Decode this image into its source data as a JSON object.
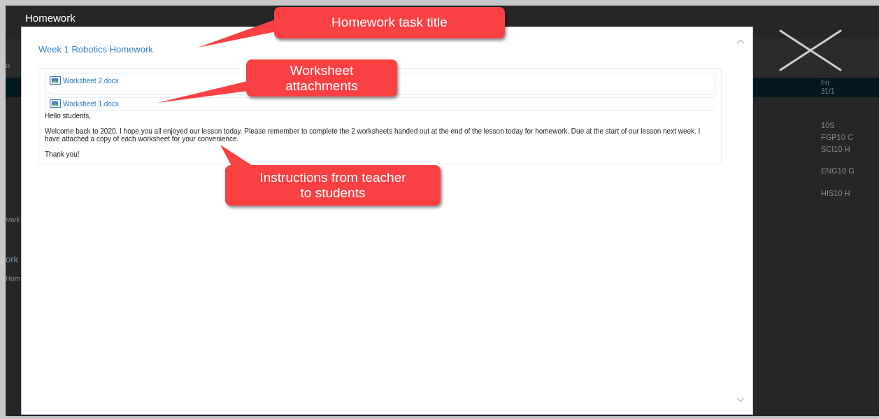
{
  "window": {
    "title": "Homework"
  },
  "background_page": {
    "left_texts": [
      "o",
      "Mark",
      "ork",
      "Hom"
    ],
    "selected_day": {
      "day": "Fri",
      "date": "31/1"
    },
    "classes": [
      "10S",
      "FGP10 C",
      "SCI10 H",
      "ENG10 G",
      "HIS10 H"
    ]
  },
  "homework": {
    "title": "Week 1 Robotics Homework",
    "attachments": [
      "Worksheet 2.docx",
      "Worksheet 1.docx"
    ],
    "separator": ".",
    "paragraphs": [
      "Hello students,",
      "Welcome  back to 2020. I hope you all enjoyed our lesson today. Please remember to complete the 2 worksheets handed out at the end of the lesson today for homework. Due at the start of our lesson next week. I have attached a copy of each worksheet for your convenience.",
      "Thank you!"
    ]
  },
  "callouts": [
    {
      "text": "Homework task title"
    },
    {
      "text": "Worksheet attachments"
    },
    {
      "text": "Instructions from teacher to students"
    }
  ]
}
